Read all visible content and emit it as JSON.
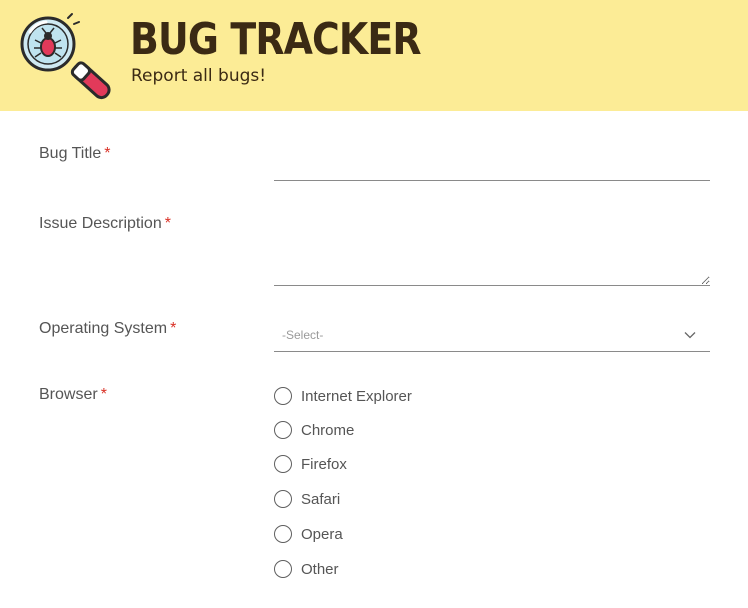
{
  "header": {
    "title": "BUG TRACKER",
    "subtitle": "Report all bugs!",
    "logo_icon": "bug-magnifier-icon",
    "background_color": "#fcec96",
    "text_color": "#3b2a14"
  },
  "form": {
    "bug_title": {
      "label": "Bug Title",
      "required_mark": "*",
      "value": ""
    },
    "issue_description": {
      "label": "Issue Description",
      "required_mark": "*",
      "value": ""
    },
    "operating_system": {
      "label": "Operating System",
      "required_mark": "*",
      "selected": "-Select-",
      "icon": "chevron-down-icon"
    },
    "browser": {
      "label": "Browser",
      "required_mark": "*",
      "options": [
        "Internet Explorer",
        "Chrome",
        "Firefox",
        "Safari",
        "Opera",
        "Other"
      ],
      "selected": null
    }
  },
  "colors": {
    "required": "#d93025",
    "label": "#555555"
  }
}
